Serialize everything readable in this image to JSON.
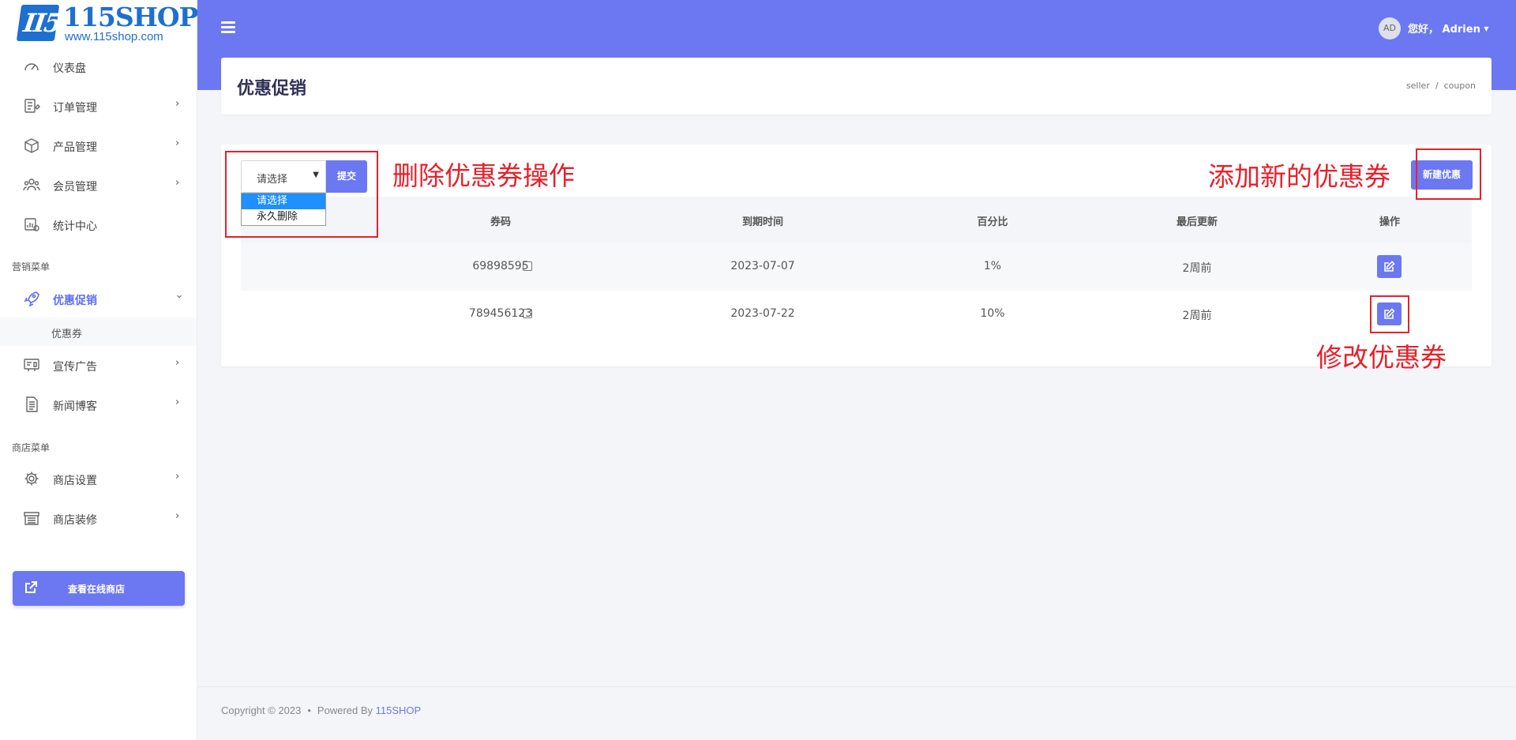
{
  "logo": {
    "text": "115SHOP",
    "url": "www.115shop.com"
  },
  "sidebar": {
    "items": [
      {
        "label": "仪表盘"
      },
      {
        "label": "订单管理"
      },
      {
        "label": "产品管理"
      },
      {
        "label": "会员管理"
      },
      {
        "label": "统计中心"
      },
      {
        "label": "优惠促销"
      },
      {
        "label": "宣传广告"
      },
      {
        "label": "新闻博客"
      },
      {
        "label": "商店设置"
      },
      {
        "label": "商店装修"
      }
    ],
    "section_marketing": "营销菜单",
    "section_store": "商店菜单",
    "sub_item": "优惠券",
    "view_store": "查看在线商店"
  },
  "topbar": {
    "avatar": "AD",
    "greeting": "您好， Adrien"
  },
  "page": {
    "title": "优惠促销",
    "breadcrumb": [
      "seller",
      "coupon"
    ]
  },
  "toolbar": {
    "select_value": "请选择",
    "options": [
      "请选择",
      "永久删除"
    ],
    "submit": "提交",
    "new_button": "新建优惠"
  },
  "table": {
    "headers": [
      "券码",
      "到期时间",
      "百分比",
      "最后更新",
      "操作"
    ],
    "rows": [
      {
        "code": "69898595",
        "expiry": "2023-07-07",
        "percent": "1%",
        "updated": "2周前"
      },
      {
        "code": "789456123",
        "expiry": "2023-07-22",
        "percent": "10%",
        "updated": "2周前"
      }
    ]
  },
  "annotations": {
    "delete": "删除优惠券操作",
    "add": "添加新的优惠券",
    "edit": "修改优惠券"
  },
  "footer": {
    "copyright": "Copyright © 2023",
    "powered": "Powered By",
    "brand": "115SHOP"
  },
  "colors": {
    "accent": "#6b78f2",
    "annotation": "#e8202a"
  }
}
